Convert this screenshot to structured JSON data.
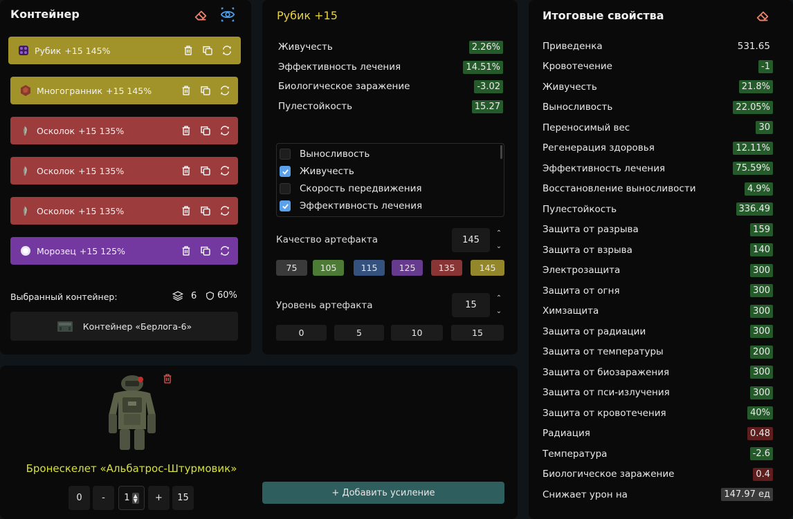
{
  "container_panel": {
    "title": "Контейнер",
    "artifacts": [
      {
        "name": "Рубик",
        "level": "+15",
        "quality": "145%",
        "color": "#a1922a",
        "icon": "rubik-icon"
      },
      {
        "name": "Многогранник",
        "level": "+15",
        "quality": "145%",
        "color": "#a1922a",
        "icon": "polyhedron-icon"
      },
      {
        "name": "Осколок",
        "level": "+15",
        "quality": "135%",
        "color": "#9c3c3c",
        "icon": "shard-icon"
      },
      {
        "name": "Осколок",
        "level": "+15",
        "quality": "135%",
        "color": "#9c3c3c",
        "icon": "shard-icon"
      },
      {
        "name": "Осколок",
        "level": "+15",
        "quality": "135%",
        "color": "#9c3c3c",
        "icon": "shard-icon"
      },
      {
        "name": "Морозец",
        "level": "+15",
        "quality": "125%",
        "color": "#7339a0",
        "icon": "frost-icon"
      }
    ],
    "selected_label": "Выбранный контейнер:",
    "slots": "6",
    "protection": "60%",
    "container_name": "Контейнер «Берлога-6»"
  },
  "artifact_panel": {
    "title": "Рубик +15",
    "stats": [
      {
        "label": "Живучесть",
        "value": "2.26%",
        "tone": "green"
      },
      {
        "label": "Эффективность лечения",
        "value": "14.51%",
        "tone": "green"
      },
      {
        "label": "Биологическое заражение",
        "value": "-3.02",
        "tone": "green"
      },
      {
        "label": "Пулестойкость",
        "value": "15.27",
        "tone": "green"
      }
    ],
    "options": [
      {
        "label": "Выносливость",
        "checked": false
      },
      {
        "label": "Живучесть",
        "checked": true
      },
      {
        "label": "Скорость передвижения",
        "checked": false
      },
      {
        "label": "Эффективность лечения",
        "checked": true
      }
    ],
    "quality_label": "Качество артефакта",
    "quality_value": "145",
    "quality_chips": [
      {
        "label": "75",
        "color": "#3a3a3a"
      },
      {
        "label": "105",
        "color": "#4d7a35"
      },
      {
        "label": "115",
        "color": "#35527e"
      },
      {
        "label": "125",
        "color": "#663a8c"
      },
      {
        "label": "135",
        "color": "#8a3535"
      },
      {
        "label": "145",
        "color": "#94862a"
      }
    ],
    "level_label": "Уровень артефакта",
    "level_value": "15",
    "level_chips": [
      "0",
      "5",
      "10",
      "15"
    ]
  },
  "totals_panel": {
    "title": "Итоговые свойства",
    "rows": [
      {
        "label": "Приведенка",
        "value": "531.65",
        "tone": "plain"
      },
      {
        "label": "Кровотечение",
        "value": "-1",
        "tone": "green"
      },
      {
        "label": "Живучесть",
        "value": "21.8%",
        "tone": "green"
      },
      {
        "label": "Выносливость",
        "value": "22.05%",
        "tone": "green"
      },
      {
        "label": "Переносимый вес",
        "value": "30",
        "tone": "green"
      },
      {
        "label": "Регенерация здоровья",
        "value": "12.11%",
        "tone": "green"
      },
      {
        "label": "Эффективность лечения",
        "value": "75.59%",
        "tone": "green"
      },
      {
        "label": "Восстановление выносливости",
        "value": "4.9%",
        "tone": "green"
      },
      {
        "label": "Пулестойкость",
        "value": "336.49",
        "tone": "green"
      },
      {
        "label": "Защита от разрыва",
        "value": "159",
        "tone": "green"
      },
      {
        "label": "Защита от взрыва",
        "value": "140",
        "tone": "green"
      },
      {
        "label": "Электрозащита",
        "value": "300",
        "tone": "green"
      },
      {
        "label": "Защита от огня",
        "value": "300",
        "tone": "green"
      },
      {
        "label": "Химзащита",
        "value": "300",
        "tone": "green"
      },
      {
        "label": "Защита от радиации",
        "value": "300",
        "tone": "green"
      },
      {
        "label": "Защита от температуры",
        "value": "200",
        "tone": "green"
      },
      {
        "label": "Защита от биозаражения",
        "value": "300",
        "tone": "green"
      },
      {
        "label": "Защита от пси-излучения",
        "value": "300",
        "tone": "green"
      },
      {
        "label": "Защита от кровотечения",
        "value": "40%",
        "tone": "green"
      },
      {
        "label": "Радиация",
        "value": "0.48",
        "tone": "red"
      },
      {
        "label": "Температура",
        "value": "-2.6",
        "tone": "green"
      },
      {
        "label": "Биологическое заражение",
        "value": "0.4",
        "tone": "red"
      },
      {
        "label": "Снижает урон на",
        "value": "147.97 ед",
        "tone": "gray"
      }
    ]
  },
  "armor_panel": {
    "name": "Бронескелет «Альбатрос-Штурмовик»",
    "min_value": "0",
    "minus_label": "-",
    "current_value": "1",
    "plus_label": "+",
    "max_value": "15",
    "add_button": "+ Добавить усиление"
  }
}
